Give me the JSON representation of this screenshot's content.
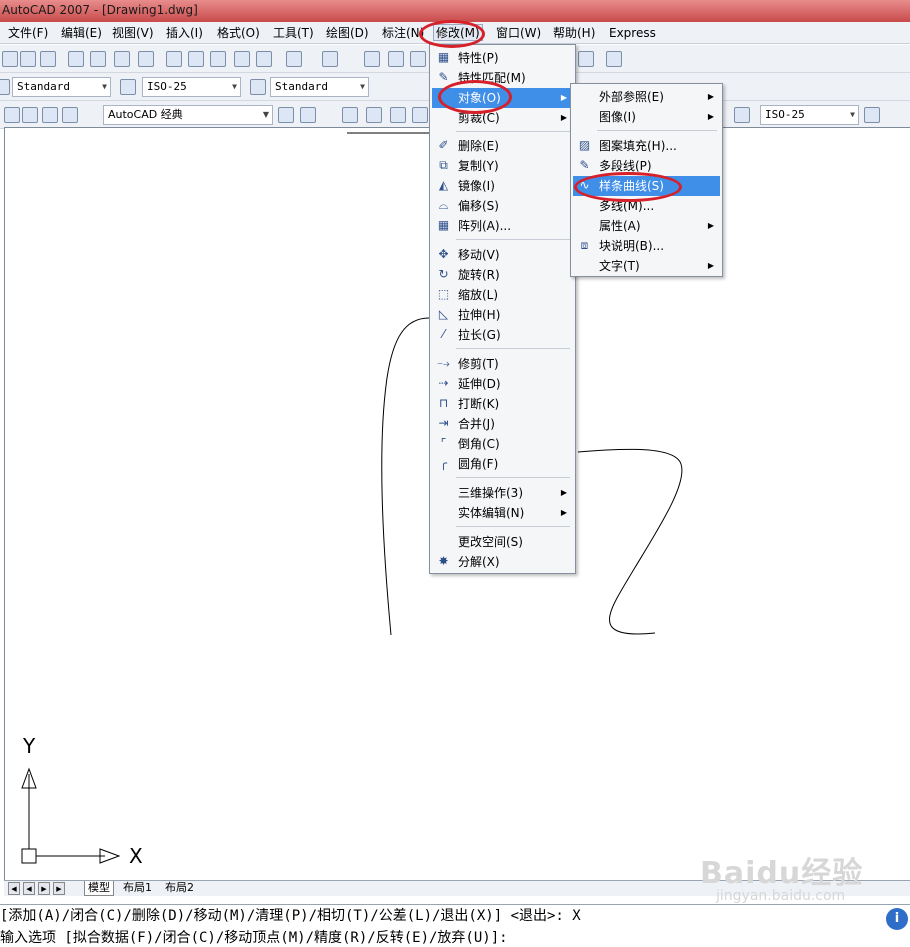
{
  "window": {
    "title": "AutoCAD 2007 - [Drawing1.dwg]"
  },
  "menubar": {
    "items": [
      "文件(F)",
      "编辑(E)",
      "视图(V)",
      "插入(I)",
      "格式(O)",
      "工具(T)",
      "绘图(D)",
      "标注(N)",
      "修改(M)",
      "窗口(W)",
      "帮助(H)",
      "Express"
    ]
  },
  "toolbar": {
    "text_style": "Standard",
    "dim_style": "ISO-25",
    "table_style": "Standard",
    "workspace": "AutoCAD 经典",
    "dim_style_right": "ISO-25"
  },
  "modify_menu": {
    "items": [
      "特性(P)",
      "特性匹配(M)",
      "对象(O)",
      "剪裁(C)",
      "删除(E)",
      "复制(Y)",
      "镜像(I)",
      "偏移(S)",
      "阵列(A)...",
      "移动(V)",
      "旋转(R)",
      "缩放(L)",
      "拉伸(H)",
      "拉长(G)",
      "修剪(T)",
      "延伸(D)",
      "打断(K)",
      "合并(J)",
      "倒角(C)",
      "圆角(F)",
      "三维操作(3)",
      "实体编辑(N)",
      "更改空间(S)",
      "分解(X)"
    ]
  },
  "object_submenu": {
    "items": [
      "外部参照(E)",
      "图像(I)",
      "图案填充(H)...",
      "多段线(P)",
      "样条曲线(S)",
      "多线(M)...",
      "属性(A)",
      "块说明(B)...",
      "文字(T)"
    ]
  },
  "ucs": {
    "y_label": "Y",
    "x_label": "X"
  },
  "tabs": {
    "model": "模型",
    "layout1": "布局1",
    "layout2": "布局2"
  },
  "command": {
    "line1": "[添加(A)/闭合(C)/删除(D)/移动(M)/清理(P)/相切(T)/公差(L)/退出(X)] <退出>: X",
    "line2": "输入选项 [拟合数据(F)/闭合(C)/移动顶点(M)/精度(R)/反转(E)/放弃(U)]:"
  },
  "watermark": {
    "brand": "Baidu经验",
    "url": "jingyan.baidu.com"
  },
  "colors": {
    "highlight": "#3f8ee8",
    "annotation_ring": "#d6202a",
    "title_bar": "#d05858"
  }
}
